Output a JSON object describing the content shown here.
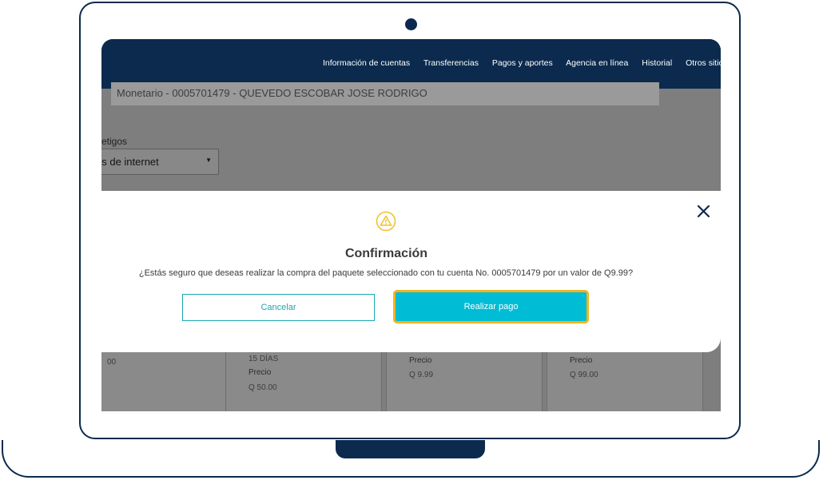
{
  "nav": {
    "items": [
      "Información de cuentas",
      "Transferencias",
      "Pagos y aportes",
      "Agencia en línea",
      "Historial",
      "Otros sitio"
    ]
  },
  "account": {
    "text": "Monetario - 0005701479 - QUEVEDO ESCOBAR JOSE RODRIGO"
  },
  "selector": {
    "label": "etigos",
    "value": "os de internet"
  },
  "modal": {
    "title": "Confirmación",
    "message": "¿Estás seguro que deseas realizar la compra del paquete seleccionado con tu cuenta No. 0005701479 por un valor de Q9.99?",
    "cancel_label": "Cancelar",
    "confirm_label": "Realizar pago",
    "icon": "warning-icon",
    "close_icon": "close-icon"
  },
  "cards": [
    {
      "duration": "",
      "price_label": "",
      "price_value": "00"
    },
    {
      "duration": "15 DÍAS",
      "price_label": "Precio",
      "price_value": "Q 50.00"
    },
    {
      "duration": "",
      "price_label": "Precio",
      "price_value": "Q 9.99"
    },
    {
      "duration": "",
      "price_label": "Precio",
      "price_value": "Q 99.00"
    }
  ],
  "colors": {
    "navy": "#0b2a4e",
    "accent": "#00bcd4",
    "highlight": "#f2b41e",
    "warning": "#f2c12e"
  }
}
